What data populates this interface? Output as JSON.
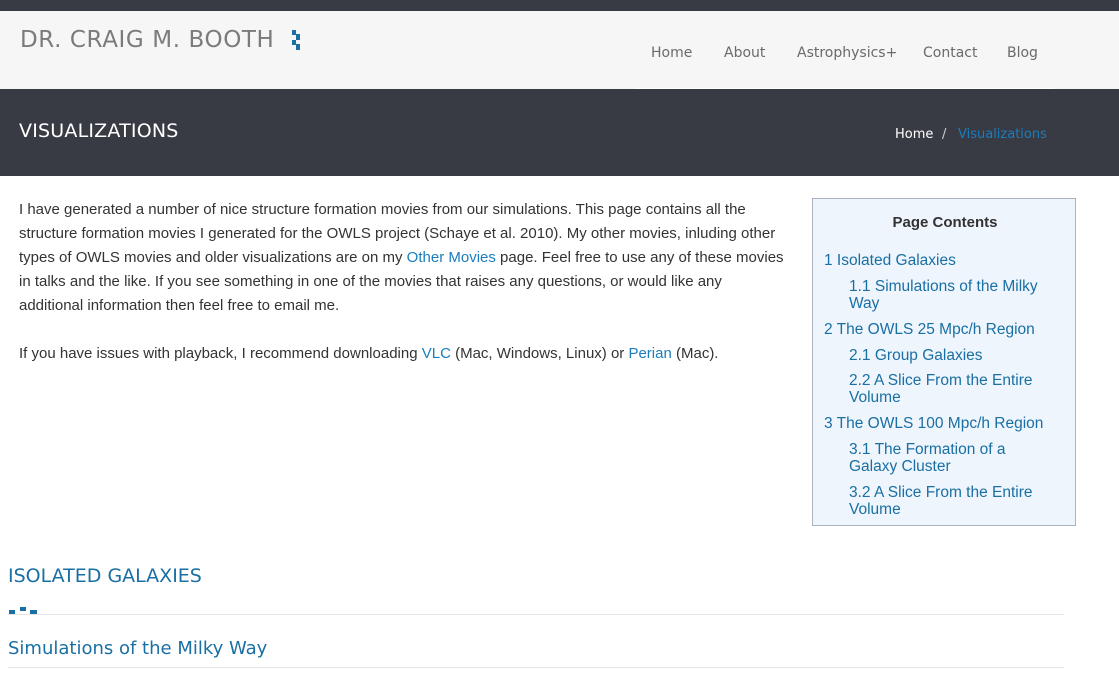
{
  "site": {
    "logo_text": "DR. CRAIG M. BOOTH",
    "brand_color": "#1a6fa3"
  },
  "nav": {
    "items": [
      {
        "label": "Home"
      },
      {
        "label": "About"
      },
      {
        "label": "Astrophysics+"
      },
      {
        "label": "Contact"
      },
      {
        "label": "Blog"
      }
    ]
  },
  "titlebar": {
    "title": "VISUALIZATIONS",
    "breadcrumb": {
      "home": "Home",
      "separator": "/",
      "current": "Visualizations"
    }
  },
  "intro": {
    "p1_part1": "I have generated a number of nice structure formation movies from our simulations. This page contains all the structure formation movies I generated for the OWLS project (Schaye et al. 2010). My other movies, inluding other types of OWLS movies and older visualizations are on my ",
    "p1_link": "Other Movies",
    "p1_part2": " page. Feel free to use any of these movies in talks and the like. If you see something in one of the movies that raises any questions, or would like any additional information then feel free to email me.",
    "p2_part1": "If you have issues with playback, I recommend downloading ",
    "p2_link1": "VLC",
    "p2_part2": " (Mac, Windows, Linux) or ",
    "p2_link2": "Perian",
    "p2_part3": " (Mac)."
  },
  "toc": {
    "title": "Page Contents",
    "items": [
      {
        "label": "1 Isolated Galaxies"
      },
      {
        "label": "1.1 Simulations of the Milky Way"
      },
      {
        "label": "2 The OWLS 25 Mpc/h Region"
      },
      {
        "label": "2.1 Group Galaxies"
      },
      {
        "label": "2.2 A Slice From the Entire Volume"
      },
      {
        "label": "3 The OWLS 100 Mpc/h Region"
      },
      {
        "label": "3.1 The Formation of a Galaxy Cluster"
      },
      {
        "label": "3.2 A Slice From the Entire Volume"
      }
    ]
  },
  "sections": {
    "heading": "ISOLATED GALAXIES",
    "subheading": "Simulations of the Milky Way"
  }
}
